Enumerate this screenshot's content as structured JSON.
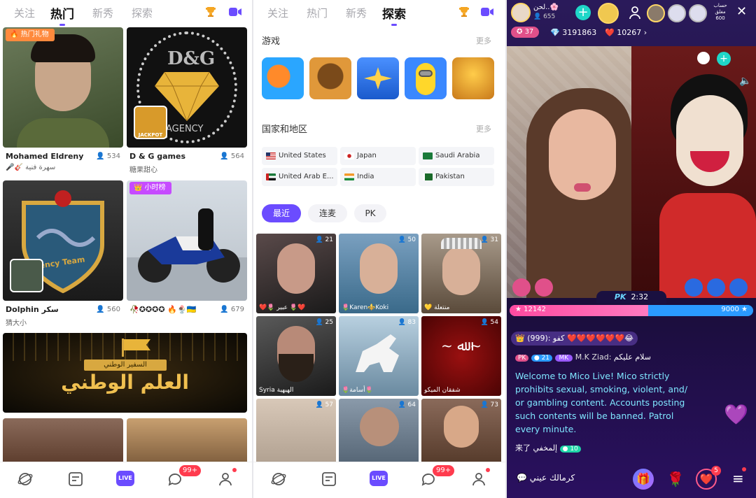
{
  "accent": "#6b4cff",
  "hot_panel": {
    "tabs": [
      {
        "label": "关注",
        "active": false
      },
      {
        "label": "热门",
        "active": true
      },
      {
        "label": "新秀",
        "active": false
      },
      {
        "label": "探索",
        "active": false
      }
    ],
    "cards": [
      {
        "name": "Mohamed Eldreny",
        "viewers": "534",
        "subtitle": "🎤🎸 سهرة فنية",
        "badge": "热门礼物",
        "thumb_color": "#4a5a3a"
      },
      {
        "name": "D & G  games",
        "viewers": "564",
        "subtitle": "糖果甜心",
        "thumb_color": "#111111",
        "thumb_text": "D&G",
        "thumb_subtext": "AGENCY",
        "game_tag": "JACKPOT"
      },
      {
        "name": "Dolphin سكر",
        "viewers": "560",
        "subtitle": "猜大小",
        "thumb_color": "#2a2a2a",
        "thumb_text": "Agency Team"
      },
      {
        "name": "🥀✪✪✪✪ 🔥🍨🇺🇦",
        "viewers": "679",
        "subtitle": "",
        "badge": "小时榜",
        "thumb_color": "#c9d4de"
      }
    ],
    "banner": {
      "title": "العلم الوطني",
      "subtitle": "السفير الوطني"
    },
    "bottom_cards": [
      {
        "thumb_color": "#6d4b3a"
      },
      {
        "thumb_color": "#8a6a3a"
      }
    ]
  },
  "explore_panel": {
    "tabs": [
      {
        "label": "关注",
        "active": false
      },
      {
        "label": "热门",
        "active": false
      },
      {
        "label": "新秀",
        "active": false
      },
      {
        "label": "探索",
        "active": true
      }
    ],
    "games_title": "游戏",
    "games_more": "更多",
    "games": [
      {
        "name": "fish-game-icon",
        "color": "#2aa6ff"
      },
      {
        "name": "lion-game-icon",
        "color": "#c0782a"
      },
      {
        "name": "plane-game-icon",
        "color": "#2a6ccc"
      },
      {
        "name": "minion-game-icon",
        "color": "#3a88ff"
      },
      {
        "name": "jackpot-game-icon",
        "color": "#d89a2a"
      }
    ],
    "countries_title": "国家和地区",
    "countries_more": "更多",
    "countries": [
      {
        "label": "United States",
        "flag": "us"
      },
      {
        "label": "Japan",
        "flag": "jp"
      },
      {
        "label": "Saudi Arabia",
        "flag": "sa"
      },
      {
        "label": "United Arab E...",
        "flag": "ae"
      },
      {
        "label": "India",
        "flag": "in"
      },
      {
        "label": "Pakistan",
        "flag": "pk"
      }
    ],
    "filters": [
      {
        "label": "最近",
        "active": true
      },
      {
        "label": "连麦",
        "active": false
      },
      {
        "label": "PK",
        "active": false
      }
    ],
    "tiles": [
      {
        "count": "21",
        "name": "❤️🌷 عبير 🌷❤️",
        "color": "#3a2a2a"
      },
      {
        "count": "50",
        "name": "🌷Karen⚜️Koki",
        "color": "#4a7a9a"
      },
      {
        "count": "31",
        "name": "💛 منتعلة",
        "color": "#6a5a4a"
      },
      {
        "count": "25",
        "name": "Syria الهيهية",
        "color": "#2a2a2a"
      },
      {
        "count": "83",
        "name": "🌷أسامة🌷",
        "color": "#7a9ab0"
      },
      {
        "count": "54",
        "name": "شفقان الميكو",
        "color": "#7a0a0a"
      },
      {
        "count": "57",
        "name": "",
        "color": "#c8b8a8"
      },
      {
        "count": "64",
        "name": "",
        "color": "#5a6a7a"
      },
      {
        "count": "73",
        "name": "",
        "color": "#6a5040"
      }
    ]
  },
  "bottom_nav": {
    "live_label": "LIVE",
    "msg_badge": "99+"
  },
  "live_room": {
    "host_name": "لحن..🌸",
    "host_viewers": "655",
    "level": "37",
    "diamonds": "3191863",
    "hearts": "10267",
    "top_right_label": "حساب مغلق 600",
    "pk_label": "PK",
    "pk_timer": "2:32",
    "score_left": "12142",
    "score_right": "9000",
    "score_left_fraction": 0.57,
    "chat": [
      {
        "text": "👑 (999): كفو ❤️❤️❤️❤️❤️❤️😂"
      },
      {
        "user": "M.K  Ziad:",
        "msg": "سلام عليكم",
        "lvl": "21",
        "tag": "MK"
      }
    ],
    "notice": "Welcome to Mico Live! Mico strictly prohibits sexual, smoking, violent, and/ or gambling content. Accounts posting such contents will be banned. Patrol every minute.",
    "join_text": "来了 إلمخفي",
    "join_lvl": "10",
    "input_text": "كرمالك عيني",
    "notif_count": "5"
  }
}
